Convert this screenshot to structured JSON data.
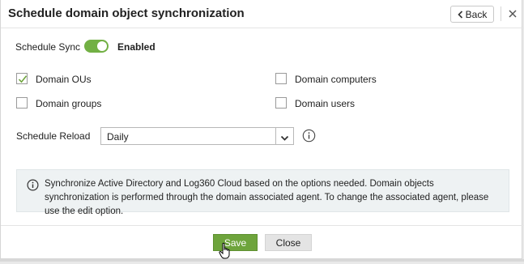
{
  "dialog": {
    "title": "Schedule domain object synchronization",
    "back_label": "Back"
  },
  "schedule_sync": {
    "label": "Schedule Sync",
    "state_label": "Enabled",
    "enabled": true
  },
  "options": [
    {
      "label": "Domain OUs",
      "checked": true
    },
    {
      "label": "Domain computers",
      "checked": false
    },
    {
      "label": "Domain groups",
      "checked": false
    },
    {
      "label": "Domain users",
      "checked": false
    }
  ],
  "schedule_reload": {
    "label": "Schedule Reload",
    "selected": "Daily"
  },
  "note": {
    "text": "Synchronize Active Directory and Log360 Cloud based on the options needed. Domain objects synchronization is performed through the domain associated agent. To change the associated agent, please use the edit option."
  },
  "footer": {
    "save_label": "Save",
    "close_label": "Close"
  },
  "colors": {
    "accent_green": "#72b044",
    "save_button": "#6ea43c",
    "note_background": "#eef2f3"
  },
  "icons": [
    "chevron-left-icon",
    "close-icon",
    "checkmark-icon",
    "chevron-down-icon",
    "info-icon",
    "hand-cursor-icon"
  ]
}
